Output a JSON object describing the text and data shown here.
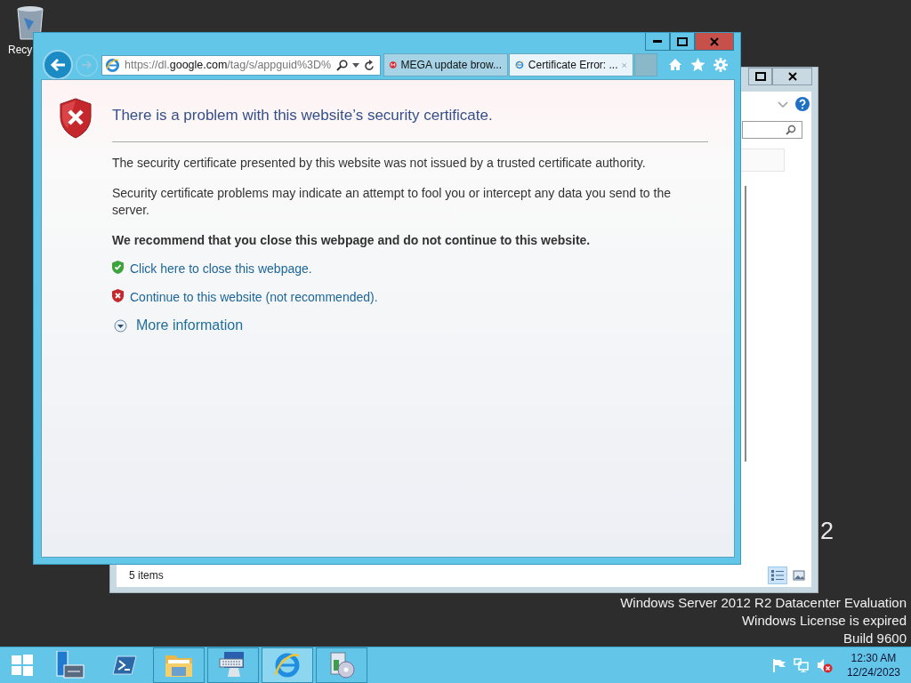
{
  "desktop": {
    "icons": [
      {
        "label": "Recy"
      }
    ],
    "watermark": {
      "edition_mark": "2",
      "lines": [
        "Windows Server 2012 R2 Datacenter Evaluation",
        "Windows License is expired",
        "Build 9600"
      ]
    }
  },
  "explorer_window": {
    "status": "5 items",
    "views": [
      {
        "kind": "details",
        "selected": true
      },
      {
        "kind": "thumbnails",
        "selected": false
      }
    ]
  },
  "browser": {
    "address": "https://dl.**google.com**/tag/s/appguid%3D%",
    "tabs": [
      {
        "kind": "mega",
        "label": "MEGA update brow...",
        "selected": false
      },
      {
        "kind": "ie",
        "label": "Certificate Error: ...",
        "selected": true
      }
    ],
    "page": {
      "heading": "There is a problem with this website’s security certificate.",
      "paragraphs": [
        {
          "kind": "plain",
          "text": "The security certificate presented by this website was not issued by a trusted certificate authority."
        },
        {
          "kind": "plain",
          "text": "Security certificate problems may indicate an attempt to fool you or intercept any data you send to the server."
        },
        {
          "kind": "strong",
          "text": "We recommend that you close this webpage and do not continue to this website."
        }
      ],
      "links": [
        {
          "kind": "safe",
          "text": "Click here to close this webpage."
        },
        {
          "kind": "danger",
          "text": "Continue to this website (not recommended)."
        }
      ],
      "more": {
        "text": "More information",
        "expanded": false
      }
    }
  },
  "taskbar": {
    "apps": [
      {
        "kind": "server-manager",
        "running": false,
        "selected": false
      },
      {
        "kind": "powershell",
        "running": false,
        "selected": false
      },
      {
        "kind": "folder",
        "running": true,
        "selected": false
      },
      {
        "kind": "keyboard",
        "running": true,
        "selected": false
      },
      {
        "kind": "ie",
        "running": true,
        "selected": true
      },
      {
        "kind": "setup",
        "running": true,
        "selected": false
      }
    ],
    "time": "12:30 AM",
    "date": "12/24/2023"
  }
}
